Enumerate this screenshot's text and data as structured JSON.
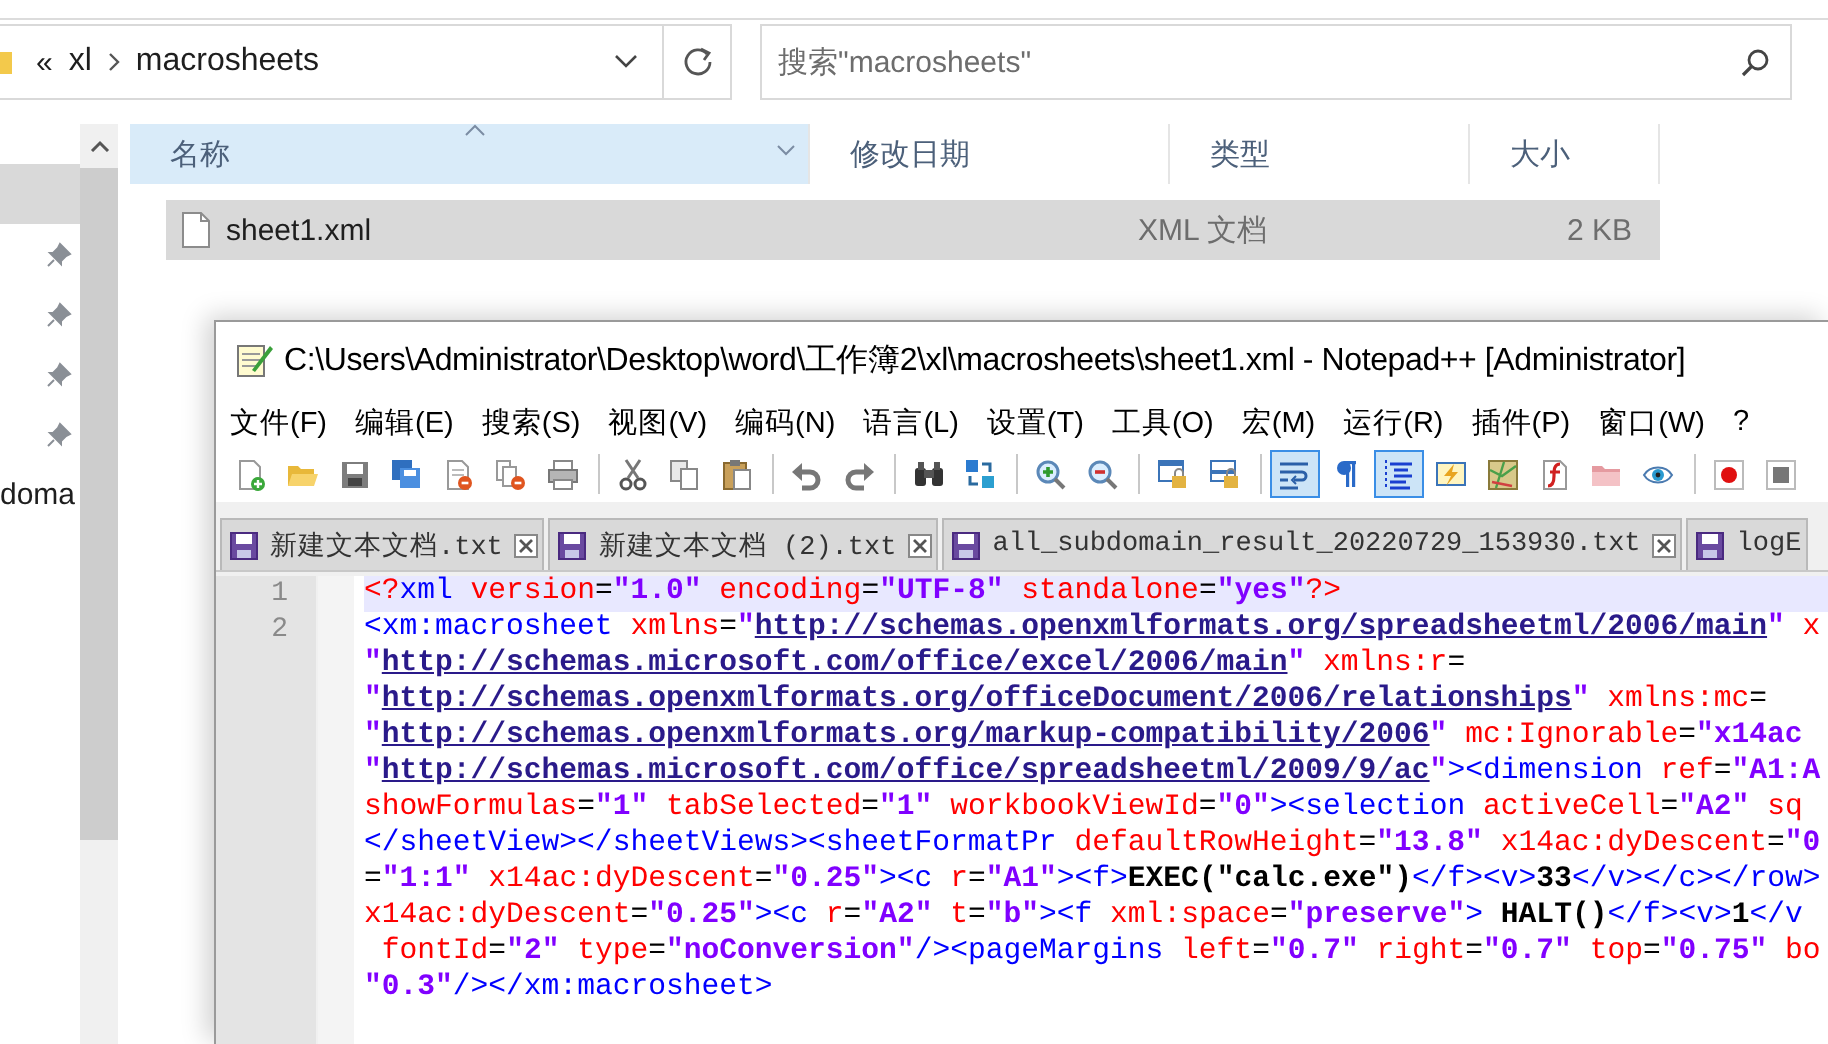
{
  "explorer": {
    "breadcrumb": {
      "overflow": "«",
      "items": [
        "xl",
        "macrosheets"
      ]
    },
    "search": {
      "placeholder": "搜索\"macrosheets\""
    },
    "nav_pane": {
      "items": [
        {
          "selected": true,
          "pinned": false
        },
        {
          "selected": false,
          "pinned": true
        },
        {
          "selected": false,
          "pinned": true
        },
        {
          "selected": false,
          "pinned": true
        },
        {
          "selected": false,
          "pinned": true
        },
        {
          "selected": false,
          "pinned": false,
          "label": "doma"
        }
      ]
    },
    "columns": [
      {
        "label": "名称",
        "sorted": true
      },
      {
        "label": "修改日期",
        "sorted": false
      },
      {
        "label": "类型",
        "sorted": false
      },
      {
        "label": "大小",
        "sorted": false
      }
    ],
    "files": [
      {
        "name": "sheet1.xml",
        "type": "XML 文档",
        "size": "2 KB",
        "selected": true
      }
    ]
  },
  "notepad": {
    "title": "C:\\Users\\Administrator\\Desktop\\word\\工作簿2\\xl\\macrosheets\\sheet1.xml - Notepad++ [Administrator]",
    "menu": [
      "文件(F)",
      "编辑(E)",
      "搜索(S)",
      "视图(V)",
      "编码(N)",
      "语言(L)",
      "设置(T)",
      "工具(O)",
      "宏(M)",
      "运行(R)",
      "插件(P)",
      "窗口(W)",
      "?"
    ],
    "toolbar": [
      {
        "on": false
      },
      {
        "on": false
      },
      {
        "on": false
      },
      {
        "on": false
      },
      {
        "on": false
      },
      {
        "on": false
      },
      {
        "on": false
      },
      {
        "on": false
      },
      {
        "on": false
      },
      {
        "on": false
      },
      {
        "on": false
      },
      {
        "on": false
      },
      {
        "on": false
      },
      {
        "on": false
      },
      {
        "on": false
      },
      {
        "on": false
      },
      {
        "on": false
      },
      {
        "on": false
      },
      {
        "on": true
      },
      {
        "on": false
      },
      {
        "on": true
      },
      {
        "on": false
      },
      {
        "on": false
      },
      {
        "on": false
      },
      {
        "on": false
      },
      {
        "on": false
      },
      {
        "on": false
      },
      {
        "on": false
      }
    ],
    "tabs": [
      {
        "label": "新建文本文档.txt",
        "selected": false
      },
      {
        "label": "新建文本文档 (2).txt",
        "selected": false
      },
      {
        "label": "all_subdomain_result_20220729_153930.txt",
        "selected": false
      },
      {
        "label": "logE",
        "selected": false
      }
    ],
    "editor": {
      "lines": [
        {
          "number": "1",
          "current": true,
          "segments": [
            {
              "kind": "pi",
              "text": "<?"
            },
            {
              "kind": "tag",
              "text": "xml "
            },
            {
              "kind": "attr",
              "text": "version"
            },
            {
              "kind": "punct",
              "text": "="
            },
            {
              "kind": "value",
              "text": "\"1.0\""
            },
            {
              "kind": "attr",
              "text": " encoding"
            },
            {
              "kind": "punct",
              "text": "="
            },
            {
              "kind": "value",
              "text": "\"UTF-8\""
            },
            {
              "kind": "attr",
              "text": " standalone"
            },
            {
              "kind": "punct",
              "text": "="
            },
            {
              "kind": "value",
              "text": "\"yes\""
            },
            {
              "kind": "pi",
              "text": "?>"
            }
          ]
        },
        {
          "number": "2",
          "current": false,
          "segments": [
            {
              "kind": "tag",
              "text": "<xm:macrosheet "
            },
            {
              "kind": "attr",
              "text": "xmlns"
            },
            {
              "kind": "punct",
              "text": "="
            },
            {
              "kind": "value",
              "text": "\""
            },
            {
              "kind": "link",
              "text": "http://schemas.openxmlformats.org/spreadsheetml/2006/main"
            },
            {
              "kind": "value",
              "text": "\""
            },
            {
              "kind": "attr",
              "text": " x"
            }
          ]
        },
        {
          "current": false,
          "segments": [
            {
              "kind": "value",
              "text": "\""
            },
            {
              "kind": "link",
              "text": "http://schemas.microsoft.com/office/excel/2006/main"
            },
            {
              "kind": "value",
              "text": "\""
            },
            {
              "kind": "attr",
              "text": " xmlns:r"
            },
            {
              "kind": "punct",
              "text": "="
            }
          ]
        },
        {
          "current": false,
          "segments": [
            {
              "kind": "value",
              "text": "\""
            },
            {
              "kind": "link",
              "text": "http://schemas.openxmlformats.org/officeDocument/2006/relationships"
            },
            {
              "kind": "value",
              "text": "\""
            },
            {
              "kind": "attr",
              "text": " xmlns:mc"
            },
            {
              "kind": "punct",
              "text": "="
            }
          ]
        },
        {
          "current": false,
          "segments": [
            {
              "kind": "value",
              "text": "\""
            },
            {
              "kind": "link",
              "text": "http://schemas.openxmlformats.org/markup-compatibility/2006"
            },
            {
              "kind": "value",
              "text": "\""
            },
            {
              "kind": "attr",
              "text": " mc:Ignorable"
            },
            {
              "kind": "punct",
              "text": "="
            },
            {
              "kind": "value",
              "text": "\"x14ac"
            }
          ]
        },
        {
          "current": false,
          "segments": [
            {
              "kind": "value",
              "text": "\""
            },
            {
              "kind": "link",
              "text": "http://schemas.microsoft.com/office/spreadsheetml/2009/9/ac"
            },
            {
              "kind": "value",
              "text": "\""
            },
            {
              "kind": "tag",
              "text": "><dimension "
            },
            {
              "kind": "attr",
              "text": "ref"
            },
            {
              "kind": "punct",
              "text": "="
            },
            {
              "kind": "value",
              "text": "\"A1:A"
            }
          ]
        },
        {
          "current": false,
          "segments": [
            {
              "kind": "attr",
              "text": "showFormulas"
            },
            {
              "kind": "punct",
              "text": "="
            },
            {
              "kind": "value",
              "text": "\"1\""
            },
            {
              "kind": "attr",
              "text": " tabSelected"
            },
            {
              "kind": "punct",
              "text": "="
            },
            {
              "kind": "value",
              "text": "\"1\""
            },
            {
              "kind": "attr",
              "text": " workbookViewId"
            },
            {
              "kind": "punct",
              "text": "="
            },
            {
              "kind": "value",
              "text": "\"0\""
            },
            {
              "kind": "tag",
              "text": "><selection "
            },
            {
              "kind": "attr",
              "text": "activeCell"
            },
            {
              "kind": "punct",
              "text": "="
            },
            {
              "kind": "value",
              "text": "\"A2\""
            },
            {
              "kind": "attr",
              "text": " sq"
            }
          ]
        },
        {
          "current": false,
          "segments": [
            {
              "kind": "tag",
              "text": "</sheetView></sheetViews><sheetFormatPr "
            },
            {
              "kind": "attr",
              "text": "defaultRowHeight"
            },
            {
              "kind": "punct",
              "text": "="
            },
            {
              "kind": "value",
              "text": "\"13.8\""
            },
            {
              "kind": "attr",
              "text": " x14ac:dyDescent"
            },
            {
              "kind": "punct",
              "text": "="
            },
            {
              "kind": "value",
              "text": "\"0"
            }
          ]
        },
        {
          "current": false,
          "segments": [
            {
              "kind": "punct",
              "text": "="
            },
            {
              "kind": "value",
              "text": "\"1:1\""
            },
            {
              "kind": "attr",
              "text": " x14ac:dyDescent"
            },
            {
              "kind": "punct",
              "text": "="
            },
            {
              "kind": "value",
              "text": "\"0.25\""
            },
            {
              "kind": "tag",
              "text": "><c "
            },
            {
              "kind": "attr",
              "text": "r"
            },
            {
              "kind": "punct",
              "text": "="
            },
            {
              "kind": "value",
              "text": "\"A1\""
            },
            {
              "kind": "tag",
              "text": "><f>"
            },
            {
              "kind": "text",
              "text": "EXEC(\"calc.exe\")"
            },
            {
              "kind": "tag",
              "text": "</f><v>"
            },
            {
              "kind": "text",
              "text": "33"
            },
            {
              "kind": "tag",
              "text": "</v></c></row>"
            }
          ]
        },
        {
          "current": false,
          "segments": [
            {
              "kind": "attr",
              "text": "x14ac:dyDescent"
            },
            {
              "kind": "punct",
              "text": "="
            },
            {
              "kind": "value",
              "text": "\"0.25\""
            },
            {
              "kind": "tag",
              "text": "><c "
            },
            {
              "kind": "attr",
              "text": "r"
            },
            {
              "kind": "punct",
              "text": "="
            },
            {
              "kind": "value",
              "text": "\"A2\""
            },
            {
              "kind": "attr",
              "text": " t"
            },
            {
              "kind": "punct",
              "text": "="
            },
            {
              "kind": "value",
              "text": "\"b\""
            },
            {
              "kind": "tag",
              "text": "><f "
            },
            {
              "kind": "attr",
              "text": "xml:space"
            },
            {
              "kind": "punct",
              "text": "="
            },
            {
              "kind": "value",
              "text": "\"preserve\""
            },
            {
              "kind": "tag",
              "text": ">"
            },
            {
              "kind": "text",
              "text": " HALT()"
            },
            {
              "kind": "tag",
              "text": "</f><v>"
            },
            {
              "kind": "text",
              "text": "1"
            },
            {
              "kind": "tag",
              "text": "</v"
            }
          ]
        },
        {
          "current": false,
          "segments": [
            {
              "kind": "attr",
              "text": " fontId"
            },
            {
              "kind": "punct",
              "text": "="
            },
            {
              "kind": "value",
              "text": "\"2\""
            },
            {
              "kind": "attr",
              "text": " type"
            },
            {
              "kind": "punct",
              "text": "="
            },
            {
              "kind": "value",
              "text": "\"noConversion\""
            },
            {
              "kind": "tag",
              "text": "/><pageMargins "
            },
            {
              "kind": "attr",
              "text": "left"
            },
            {
              "kind": "punct",
              "text": "="
            },
            {
              "kind": "value",
              "text": "\"0.7\""
            },
            {
              "kind": "attr",
              "text": " right"
            },
            {
              "kind": "punct",
              "text": "="
            },
            {
              "kind": "value",
              "text": "\"0.7\""
            },
            {
              "kind": "attr",
              "text": " top"
            },
            {
              "kind": "punct",
              "text": "="
            },
            {
              "kind": "value",
              "text": "\"0.75\""
            },
            {
              "kind": "attr",
              "text": " bo"
            }
          ]
        },
        {
          "current": false,
          "segments": [
            {
              "kind": "value",
              "text": "\"0.3\""
            },
            {
              "kind": "tag",
              "text": "/></xm:macrosheet>"
            }
          ]
        }
      ]
    }
  }
}
